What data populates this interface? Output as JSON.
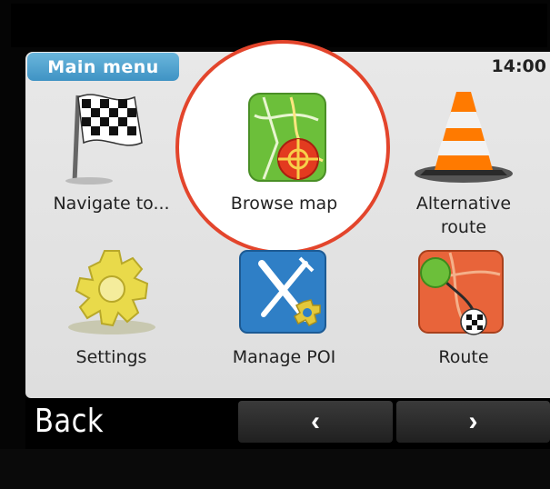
{
  "header": {
    "title": "Main menu",
    "time": "14:00"
  },
  "tiles": [
    {
      "label": "Navigate to...",
      "icon": "checkered-flag-icon"
    },
    {
      "label": "Browse map",
      "icon": "map-icon"
    },
    {
      "label": "Alternative route",
      "line1": "Alternative",
      "line2": "route",
      "icon": "traffic-cone-icon"
    },
    {
      "label": "Settings",
      "icon": "gear-icon"
    },
    {
      "label": "Manage POI",
      "icon": "fork-knife-icon"
    },
    {
      "label": "Route",
      "icon": "route-map-icon"
    }
  ],
  "footer": {
    "back_label": "Back",
    "prev_glyph": "‹",
    "next_glyph": "›"
  },
  "colors": {
    "badge": "#4aa3d3",
    "highlight": "#e3452c",
    "screen": "#e3e3e3"
  }
}
